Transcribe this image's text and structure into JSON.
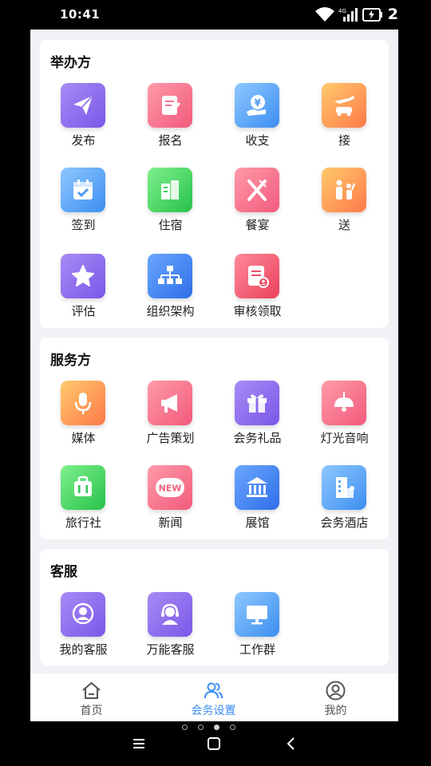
{
  "status_bar": {
    "time": "10:41",
    "network": "4G",
    "battery_num": "2"
  },
  "sections": {
    "organizer": {
      "title": "举办方",
      "items": [
        {
          "label": "发布",
          "icon": "paper-plane-icon",
          "color": "purple"
        },
        {
          "label": "报名",
          "icon": "sign-up-form-icon",
          "color": "pink"
        },
        {
          "label": "收支",
          "icon": "yuan-hand-icon",
          "color": "blue"
        },
        {
          "label": "接",
          "icon": "plane-car-icon",
          "color": "orange"
        },
        {
          "label": "签到",
          "icon": "calendar-check-icon",
          "color": "blue"
        },
        {
          "label": "住宿",
          "icon": "building-icon",
          "color": "green"
        },
        {
          "label": "餐宴",
          "icon": "fork-knife-icon",
          "color": "pink"
        },
        {
          "label": "送",
          "icon": "people-wave-icon",
          "color": "orange"
        },
        {
          "label": "评估",
          "icon": "star-icon",
          "color": "purple"
        },
        {
          "label": "组织架构",
          "icon": "org-chart-icon",
          "color": "deepblue"
        },
        {
          "label": "审核领取",
          "icon": "review-document-icon",
          "color": "red"
        }
      ]
    },
    "services": {
      "title": "服务方",
      "items": [
        {
          "label": "媒体",
          "icon": "microphone-icon",
          "color": "orange"
        },
        {
          "label": "广告策划",
          "icon": "megaphone-icon",
          "color": "pink"
        },
        {
          "label": "会务礼品",
          "icon": "gift-icon",
          "color": "purple"
        },
        {
          "label": "灯光音响",
          "icon": "ceiling-lamp-icon",
          "color": "pink"
        },
        {
          "label": "旅行社",
          "icon": "suitcase-icon",
          "color": "green"
        },
        {
          "label": "新闻",
          "icon": "new-badge-icon",
          "color": "pink",
          "badge": "NEW"
        },
        {
          "label": "展馆",
          "icon": "museum-icon",
          "color": "deepblue"
        },
        {
          "label": "会务酒店",
          "icon": "hotel-icon",
          "color": "blue"
        }
      ]
    },
    "support": {
      "title": "客服",
      "items": [
        {
          "label": "我的客服",
          "icon": "service-agent-icon",
          "color": "purple"
        },
        {
          "label": "万能客服",
          "icon": "headset-agent-icon",
          "color": "purple"
        },
        {
          "label": "工作群",
          "icon": "monitor-icon",
          "color": "blue"
        }
      ]
    }
  },
  "bottom_nav": {
    "items": [
      {
        "label": "首页",
        "icon": "home-icon"
      },
      {
        "label": "会务设置",
        "icon": "people-icon",
        "active": true
      },
      {
        "label": "我的",
        "icon": "user-circle-icon"
      }
    ]
  },
  "colors": {
    "accent": "#3b8ef2",
    "background": "#f1f2f5"
  }
}
